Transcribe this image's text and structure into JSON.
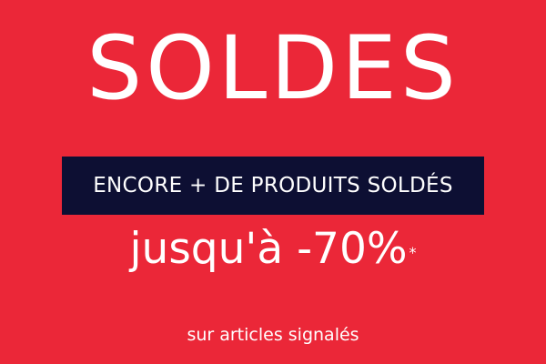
{
  "banner": {
    "title": "SOLDES",
    "subtitle": "ENCORE + DE PRODUITS SOLDÉS",
    "discount": "jusqu'à -70%",
    "asterisk": "*",
    "footnote": "sur articles signalés"
  },
  "colors": {
    "background": "#EB2738",
    "subtitle_box": "#0D0F33",
    "text": "#FFFFFF"
  }
}
